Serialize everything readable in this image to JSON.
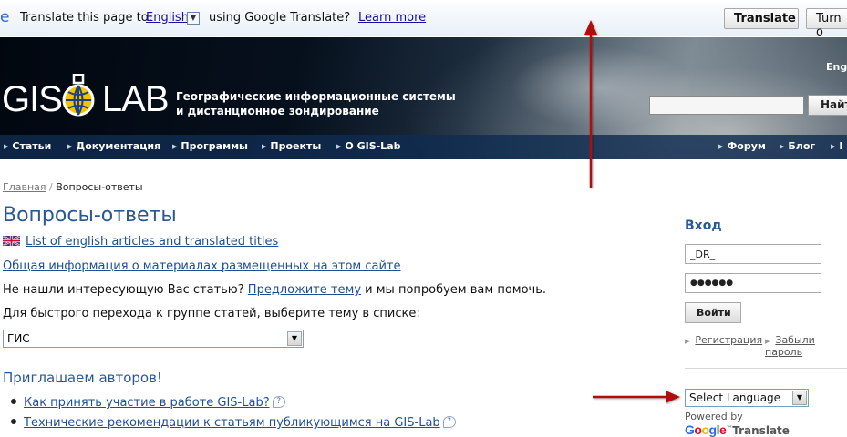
{
  "translate_bar": {
    "logo_letter": "e",
    "prefix": "Translate this page to:",
    "language": "English",
    "dropdown_glyph": "▼",
    "suffix": "using Google Translate?",
    "learn_more": "Learn more",
    "translate_button": "Translate",
    "turn_off_button": "Turn o"
  },
  "header": {
    "logo_left": "GIS",
    "logo_right": "LAB",
    "tagline_line1": "Географические информационные системы",
    "tagline_line2": "и дистанционное зондирование",
    "language_link": "Engl",
    "search_button": "Найт",
    "nav_left": [
      "Статьи",
      "Документация",
      "Программы",
      "Проекты",
      "О GIS-Lab"
    ],
    "nav_right": [
      "Форум",
      "Блог",
      "I"
    ]
  },
  "breadcrumb": {
    "home": "Главная",
    "separator": "/",
    "current": "Вопросы-ответы"
  },
  "main": {
    "title": "Вопросы-ответы",
    "english_link": "List of english articles and translated titles",
    "general_info_link": "Общая информация о материалах размещенных на этом сайте",
    "not_found_prefix": "Не нашли интересующую Вас статью?",
    "suggest_link": "Предложите тему",
    "not_found_suffix": "и мы попробуем вам помочь.",
    "quick_nav_text": "Для быстрого перехода к группе статей, выберите тему в списке:",
    "topic_selected": "ГИС",
    "authors_title": "Приглашаем авторов!",
    "author_links": [
      "Как принять участие в работе GIS-Lab?",
      "Технические рекомендации к статьям публикующимся на GIS-Lab"
    ],
    "help_glyph": "?"
  },
  "login": {
    "title": "Вход",
    "username_value": "_DR_",
    "password_value": "●●●●●●",
    "login_button": "Войти",
    "register_link": "Регистрация",
    "forgot_link": "Забыли пароль"
  },
  "language_widget": {
    "selected": "Select Language",
    "powered_by": "Powered by",
    "google_letters": [
      "G",
      "o",
      "o",
      "g",
      "l",
      "e"
    ],
    "translate_word": "Translate",
    "tm": "™"
  },
  "colors": {
    "accent_blue": "#2a5795",
    "link_blue": "#1e4d9a",
    "arrow_red": "#b01010",
    "google_blue": "#3369e8",
    "google_red": "#d50f25",
    "google_yellow": "#eeb211",
    "google_green": "#009925"
  }
}
